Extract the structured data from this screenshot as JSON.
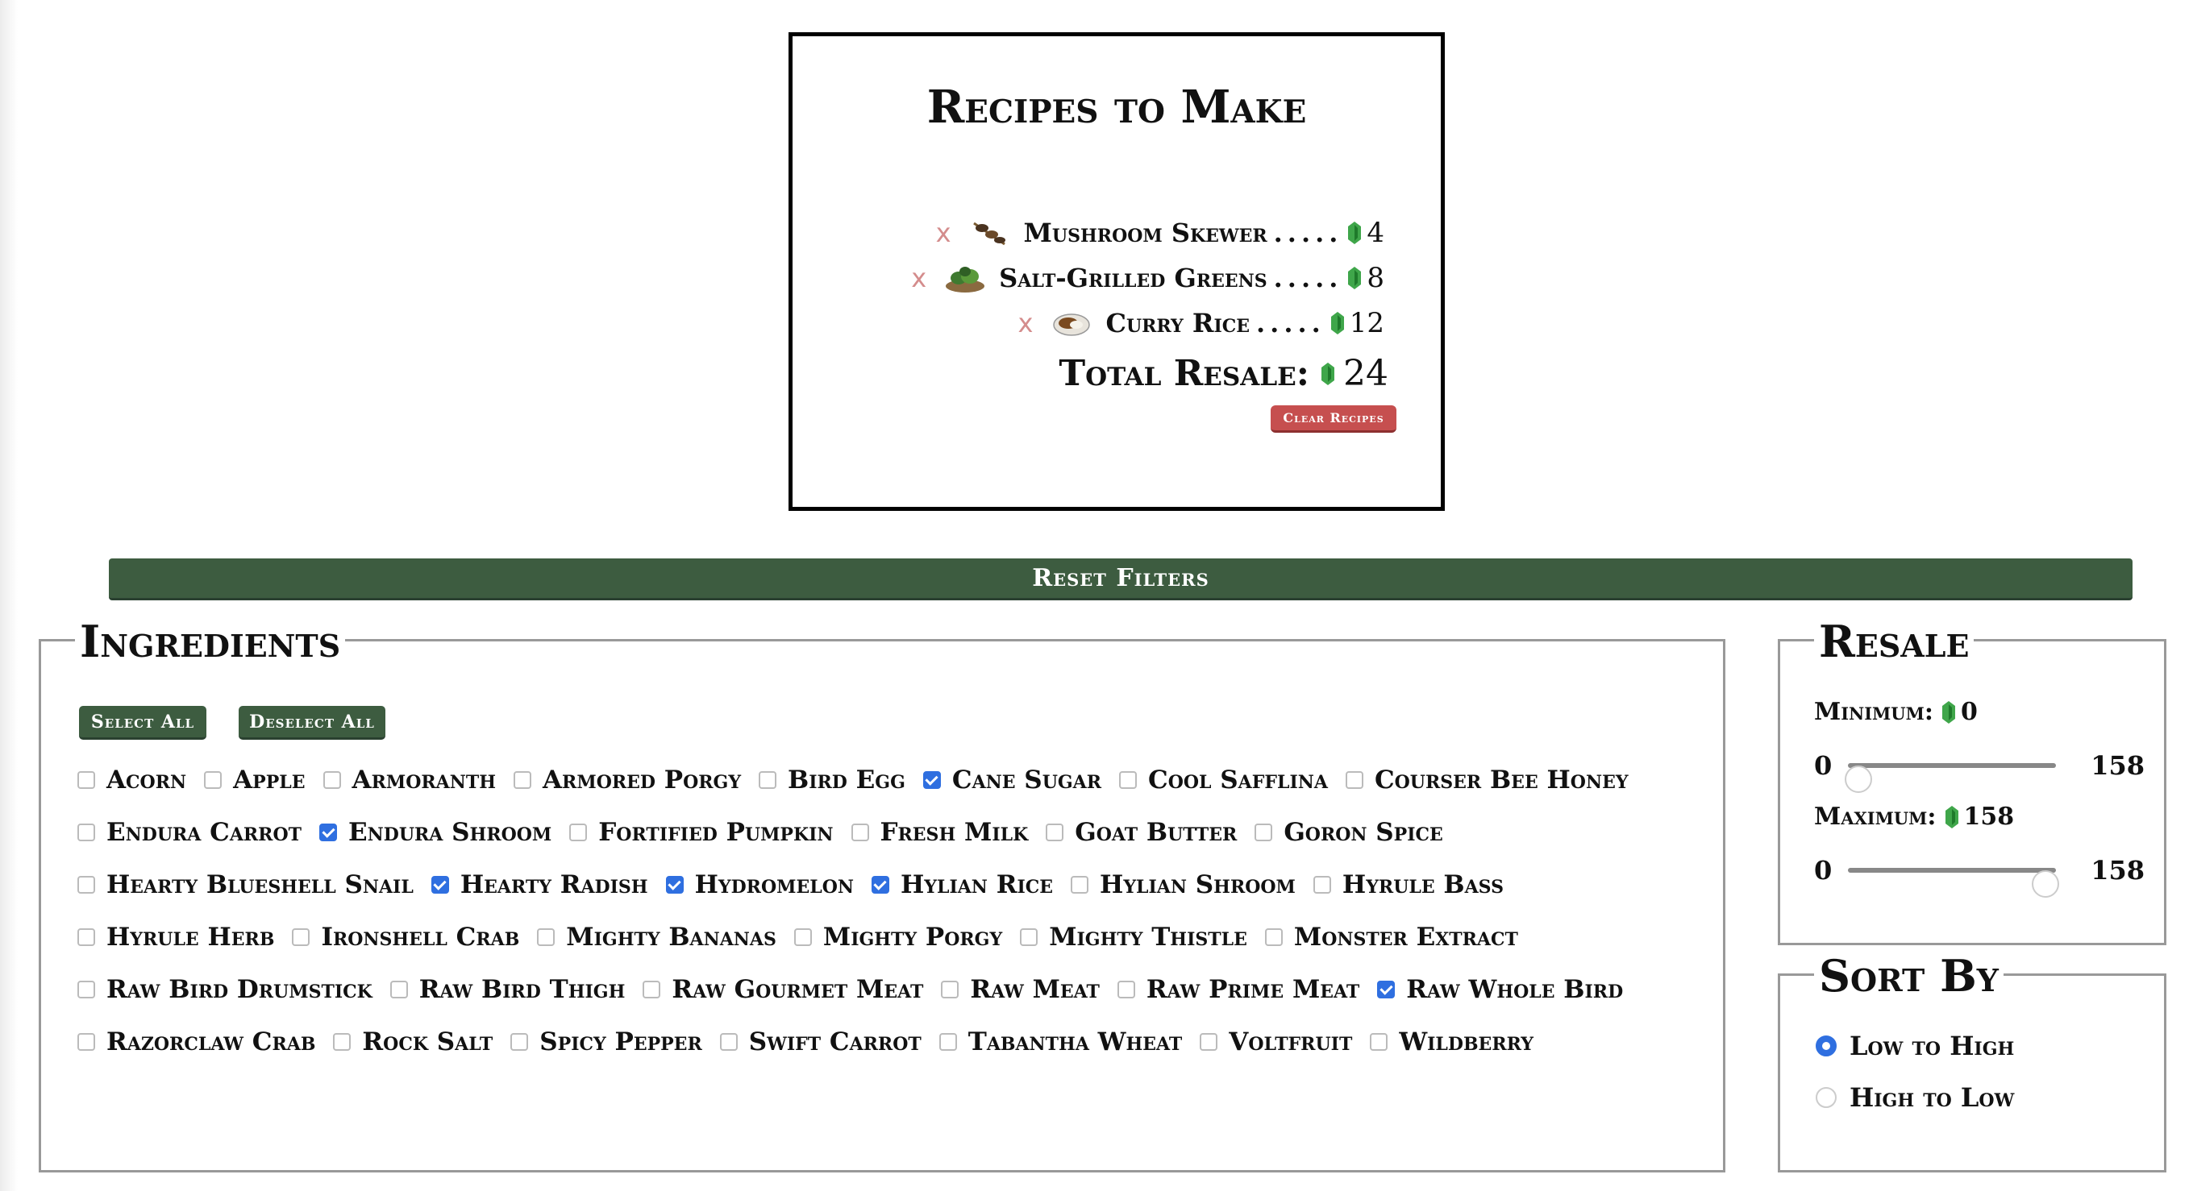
{
  "recipes": {
    "title": "Recipes to Make",
    "remove_label": "x",
    "dots": ".....",
    "items": [
      {
        "name": "Mushroom Skewer",
        "price": "4",
        "icon": "mushroom-skewer-icon"
      },
      {
        "name": "Salt-Grilled Greens",
        "price": "8",
        "icon": "salt-grilled-greens-icon"
      },
      {
        "name": "Curry Rice",
        "price": "12",
        "icon": "curry-rice-icon"
      }
    ],
    "total_label": "Total Resale:",
    "total_value": "24",
    "clear_label": "Clear Recipes"
  },
  "filters": {
    "reset_label": "Reset Filters"
  },
  "ingredients": {
    "legend": "Ingredients",
    "select_all": "Select All",
    "deselect_all": "Deselect All",
    "items": [
      {
        "label": "Acorn",
        "checked": false
      },
      {
        "label": "Apple",
        "checked": false
      },
      {
        "label": "Armoranth",
        "checked": false
      },
      {
        "label": "Armored Porgy",
        "checked": false
      },
      {
        "label": "Bird Egg",
        "checked": false
      },
      {
        "label": "Cane Sugar",
        "checked": true
      },
      {
        "label": "Cool Safflina",
        "checked": false
      },
      {
        "label": "Courser Bee Honey",
        "checked": false
      },
      {
        "label": "Endura Carrot",
        "checked": false
      },
      {
        "label": "Endura Shroom",
        "checked": true
      },
      {
        "label": "Fortified Pumpkin",
        "checked": false
      },
      {
        "label": "Fresh Milk",
        "checked": false
      },
      {
        "label": "Goat Butter",
        "checked": false
      },
      {
        "label": "Goron Spice",
        "checked": false
      },
      {
        "label": "Hearty Blueshell Snail",
        "checked": false
      },
      {
        "label": "Hearty Radish",
        "checked": true
      },
      {
        "label": "Hydromelon",
        "checked": true
      },
      {
        "label": "Hylian Rice",
        "checked": true
      },
      {
        "label": "Hylian Shroom",
        "checked": false
      },
      {
        "label": "Hyrule Bass",
        "checked": false
      },
      {
        "label": "Hyrule Herb",
        "checked": false
      },
      {
        "label": "Ironshell Crab",
        "checked": false
      },
      {
        "label": "Mighty Bananas",
        "checked": false
      },
      {
        "label": "Mighty Porgy",
        "checked": false
      },
      {
        "label": "Mighty Thistle",
        "checked": false
      },
      {
        "label": "Monster Extract",
        "checked": false
      },
      {
        "label": "Raw Bird Drumstick",
        "checked": false
      },
      {
        "label": "Raw Bird Thigh",
        "checked": false
      },
      {
        "label": "Raw Gourmet Meat",
        "checked": false
      },
      {
        "label": "Raw Meat",
        "checked": false
      },
      {
        "label": "Raw Prime Meat",
        "checked": false
      },
      {
        "label": "Raw Whole Bird",
        "checked": true
      },
      {
        "label": "Razorclaw Crab",
        "checked": false
      },
      {
        "label": "Rock Salt",
        "checked": false
      },
      {
        "label": "Spicy Pepper",
        "checked": false
      },
      {
        "label": "Swift Carrot",
        "checked": false
      },
      {
        "label": "Tabantha Wheat",
        "checked": false
      },
      {
        "label": "Voltfruit",
        "checked": false
      },
      {
        "label": "Wildberry",
        "checked": false
      }
    ]
  },
  "resale": {
    "legend": "Resale",
    "minimum_label": "Minimum:",
    "minimum_value": "0",
    "maximum_label": "Maximum:",
    "maximum_value": "158",
    "range_min": "0",
    "range_max": "158",
    "min_slider_fraction": 0.0,
    "max_slider_fraction": 1.0
  },
  "sort": {
    "legend": "Sort By",
    "options": [
      {
        "label": "Low to High",
        "selected": true
      },
      {
        "label": "High to Low",
        "selected": false
      }
    ]
  },
  "colors": {
    "accent_green": "#3d5c40",
    "clear_red": "#c64f4f",
    "rupee_green": "#3fa64a",
    "check_blue": "#2f6fe0"
  }
}
